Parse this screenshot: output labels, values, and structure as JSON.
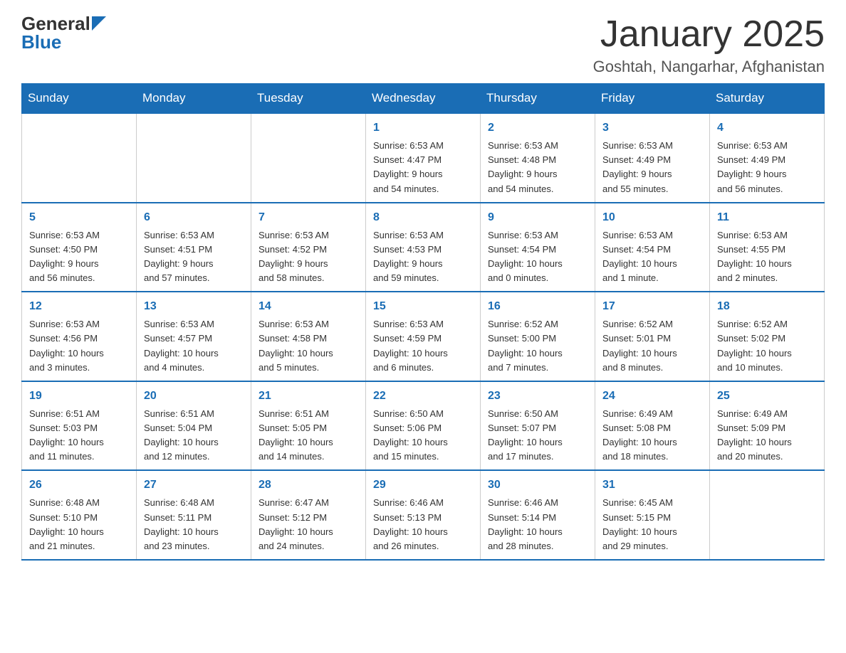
{
  "logo": {
    "general": "General",
    "blue": "Blue"
  },
  "title": "January 2025",
  "subtitle": "Goshtah, Nangarhar, Afghanistan",
  "days_of_week": [
    "Sunday",
    "Monday",
    "Tuesday",
    "Wednesday",
    "Thursday",
    "Friday",
    "Saturday"
  ],
  "weeks": [
    [
      {
        "day": "",
        "info": ""
      },
      {
        "day": "",
        "info": ""
      },
      {
        "day": "",
        "info": ""
      },
      {
        "day": "1",
        "info": "Sunrise: 6:53 AM\nSunset: 4:47 PM\nDaylight: 9 hours\nand 54 minutes."
      },
      {
        "day": "2",
        "info": "Sunrise: 6:53 AM\nSunset: 4:48 PM\nDaylight: 9 hours\nand 54 minutes."
      },
      {
        "day": "3",
        "info": "Sunrise: 6:53 AM\nSunset: 4:49 PM\nDaylight: 9 hours\nand 55 minutes."
      },
      {
        "day": "4",
        "info": "Sunrise: 6:53 AM\nSunset: 4:49 PM\nDaylight: 9 hours\nand 56 minutes."
      }
    ],
    [
      {
        "day": "5",
        "info": "Sunrise: 6:53 AM\nSunset: 4:50 PM\nDaylight: 9 hours\nand 56 minutes."
      },
      {
        "day": "6",
        "info": "Sunrise: 6:53 AM\nSunset: 4:51 PM\nDaylight: 9 hours\nand 57 minutes."
      },
      {
        "day": "7",
        "info": "Sunrise: 6:53 AM\nSunset: 4:52 PM\nDaylight: 9 hours\nand 58 minutes."
      },
      {
        "day": "8",
        "info": "Sunrise: 6:53 AM\nSunset: 4:53 PM\nDaylight: 9 hours\nand 59 minutes."
      },
      {
        "day": "9",
        "info": "Sunrise: 6:53 AM\nSunset: 4:54 PM\nDaylight: 10 hours\nand 0 minutes."
      },
      {
        "day": "10",
        "info": "Sunrise: 6:53 AM\nSunset: 4:54 PM\nDaylight: 10 hours\nand 1 minute."
      },
      {
        "day": "11",
        "info": "Sunrise: 6:53 AM\nSunset: 4:55 PM\nDaylight: 10 hours\nand 2 minutes."
      }
    ],
    [
      {
        "day": "12",
        "info": "Sunrise: 6:53 AM\nSunset: 4:56 PM\nDaylight: 10 hours\nand 3 minutes."
      },
      {
        "day": "13",
        "info": "Sunrise: 6:53 AM\nSunset: 4:57 PM\nDaylight: 10 hours\nand 4 minutes."
      },
      {
        "day": "14",
        "info": "Sunrise: 6:53 AM\nSunset: 4:58 PM\nDaylight: 10 hours\nand 5 minutes."
      },
      {
        "day": "15",
        "info": "Sunrise: 6:53 AM\nSunset: 4:59 PM\nDaylight: 10 hours\nand 6 minutes."
      },
      {
        "day": "16",
        "info": "Sunrise: 6:52 AM\nSunset: 5:00 PM\nDaylight: 10 hours\nand 7 minutes."
      },
      {
        "day": "17",
        "info": "Sunrise: 6:52 AM\nSunset: 5:01 PM\nDaylight: 10 hours\nand 8 minutes."
      },
      {
        "day": "18",
        "info": "Sunrise: 6:52 AM\nSunset: 5:02 PM\nDaylight: 10 hours\nand 10 minutes."
      }
    ],
    [
      {
        "day": "19",
        "info": "Sunrise: 6:51 AM\nSunset: 5:03 PM\nDaylight: 10 hours\nand 11 minutes."
      },
      {
        "day": "20",
        "info": "Sunrise: 6:51 AM\nSunset: 5:04 PM\nDaylight: 10 hours\nand 12 minutes."
      },
      {
        "day": "21",
        "info": "Sunrise: 6:51 AM\nSunset: 5:05 PM\nDaylight: 10 hours\nand 14 minutes."
      },
      {
        "day": "22",
        "info": "Sunrise: 6:50 AM\nSunset: 5:06 PM\nDaylight: 10 hours\nand 15 minutes."
      },
      {
        "day": "23",
        "info": "Sunrise: 6:50 AM\nSunset: 5:07 PM\nDaylight: 10 hours\nand 17 minutes."
      },
      {
        "day": "24",
        "info": "Sunrise: 6:49 AM\nSunset: 5:08 PM\nDaylight: 10 hours\nand 18 minutes."
      },
      {
        "day": "25",
        "info": "Sunrise: 6:49 AM\nSunset: 5:09 PM\nDaylight: 10 hours\nand 20 minutes."
      }
    ],
    [
      {
        "day": "26",
        "info": "Sunrise: 6:48 AM\nSunset: 5:10 PM\nDaylight: 10 hours\nand 21 minutes."
      },
      {
        "day": "27",
        "info": "Sunrise: 6:48 AM\nSunset: 5:11 PM\nDaylight: 10 hours\nand 23 minutes."
      },
      {
        "day": "28",
        "info": "Sunrise: 6:47 AM\nSunset: 5:12 PM\nDaylight: 10 hours\nand 24 minutes."
      },
      {
        "day": "29",
        "info": "Sunrise: 6:46 AM\nSunset: 5:13 PM\nDaylight: 10 hours\nand 26 minutes."
      },
      {
        "day": "30",
        "info": "Sunrise: 6:46 AM\nSunset: 5:14 PM\nDaylight: 10 hours\nand 28 minutes."
      },
      {
        "day": "31",
        "info": "Sunrise: 6:45 AM\nSunset: 5:15 PM\nDaylight: 10 hours\nand 29 minutes."
      },
      {
        "day": "",
        "info": ""
      }
    ]
  ]
}
